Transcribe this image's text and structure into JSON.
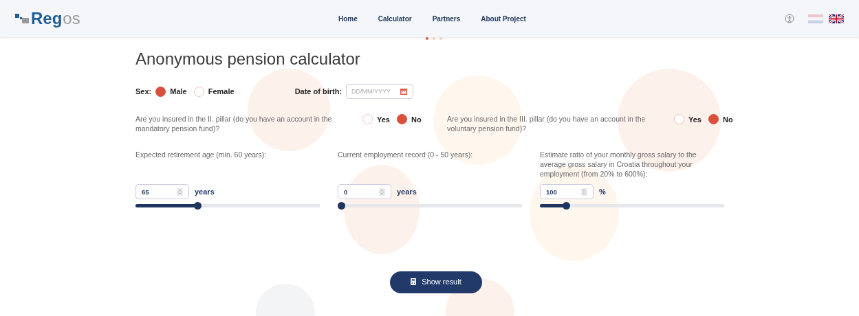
{
  "header": {
    "logo": {
      "primary": "Reg",
      "secondary": "os"
    },
    "nav": [
      {
        "label": "Home"
      },
      {
        "label": "Calculator"
      },
      {
        "label": "Partners"
      },
      {
        "label": "About Project"
      }
    ],
    "pager": [
      {
        "selected": true
      },
      {
        "selected": false
      },
      {
        "selected": false
      }
    ],
    "languages": [
      {
        "kind": "croatian",
        "selected": false
      },
      {
        "kind": "english",
        "selected": true
      }
    ]
  },
  "title": "Anonymous pension calculator",
  "sex": {
    "label": "Sex:",
    "options": [
      {
        "label": "Male",
        "selected": true
      },
      {
        "label": "Female",
        "selected": false
      }
    ]
  },
  "birth": {
    "label": "Date of birth:",
    "placeholder": "DD/MM/YYYY"
  },
  "pillars": [
    {
      "question": "Are you insured in the II. pillar (do you have an account in the mandatory pension fund)?",
      "options": [
        {
          "label": "Yes",
          "selected": false
        },
        {
          "label": "No",
          "selected": true
        }
      ]
    },
    {
      "question": "Are you insured in the III. pillar (do you have an account in the voluntary pension fund)?",
      "options": [
        {
          "label": "Yes",
          "selected": false
        },
        {
          "label": "No",
          "selected": true
        }
      ]
    }
  ],
  "sliders": [
    {
      "label": "Expected retirement age (min. 60 years):",
      "value": "65",
      "unit": "years",
      "level": 0.33
    },
    {
      "label": "Current employment record (0 - 50 years):",
      "value": "0",
      "unit": "years",
      "level": 0
    },
    {
      "label": "Estimate ratio of your monthly gross salary to the average gross salary in Croatia throughout your employment (from 20% to 600%):",
      "value": "100",
      "unit": "%",
      "level": 0.13
    }
  ],
  "button": "Show result"
}
